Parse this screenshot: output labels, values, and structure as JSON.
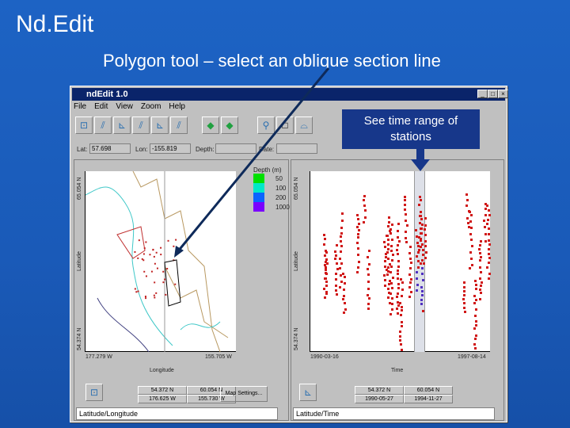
{
  "slide": {
    "title": "Nd.Edit",
    "subtitle": "Polygon tool – select an oblique section line",
    "callout": "See time range of stations"
  },
  "window": {
    "title": "ndEdit 1.0",
    "controls": [
      "_",
      "□",
      "×"
    ]
  },
  "menu": [
    "File",
    "Edit",
    "View",
    "Zoom",
    "Help"
  ],
  "toolbar": {
    "icons": [
      "map-view-icon",
      "lat-depth-icon",
      "lat-time-icon",
      "lon-depth-icon",
      "lon-time-icon",
      "depth-time-icon",
      "back-arrow-icon",
      "forward-arrow-icon",
      "zoom-icon",
      "rectangle-tool-icon",
      "polygon-tool-icon"
    ]
  },
  "fields": {
    "lat_label": "Lat:",
    "lat_value": "57.698",
    "lon_label": "Lon:",
    "lon_value": "-155.819",
    "depth_label": "Depth:",
    "depth_value": "",
    "date_label": "Date:",
    "date_value": ""
  },
  "left_panel": {
    "y_top": "65.054 N",
    "y_bottom": "54.374 N",
    "ylabel": "Latitude",
    "x_left": "177.279 W",
    "x_right": "155.705 W",
    "xlabel": "Longitude",
    "legend": {
      "title": "Depth (m)",
      "items": [
        {
          "label": "50",
          "color": "#00e000"
        },
        {
          "label": "100",
          "color": "#00e8c8"
        },
        {
          "label": "200",
          "color": "#0a64ff"
        },
        {
          "label": "1000",
          "color": "#7a00ff"
        }
      ]
    },
    "range": [
      "54.372 N",
      "60.054 N",
      "176.625 W",
      "155.730 W"
    ],
    "map_settings": "Map Settings...",
    "status": "Latitude/Longitude"
  },
  "right_panel": {
    "y_top": "65.054 N",
    "y_bottom": "54.374 N",
    "ylabel": "Latitude",
    "x_left": "1990-03-16",
    "x_right": "1997-08-14",
    "xlabel": "Time",
    "range": [
      "54.372 N",
      "60.054 N",
      "1990-05-27",
      "1994-11-27"
    ],
    "status": "Latitude/Time"
  },
  "colors": {
    "accent": "#17378a",
    "points": "#d01818",
    "selected": "#5030c0"
  }
}
